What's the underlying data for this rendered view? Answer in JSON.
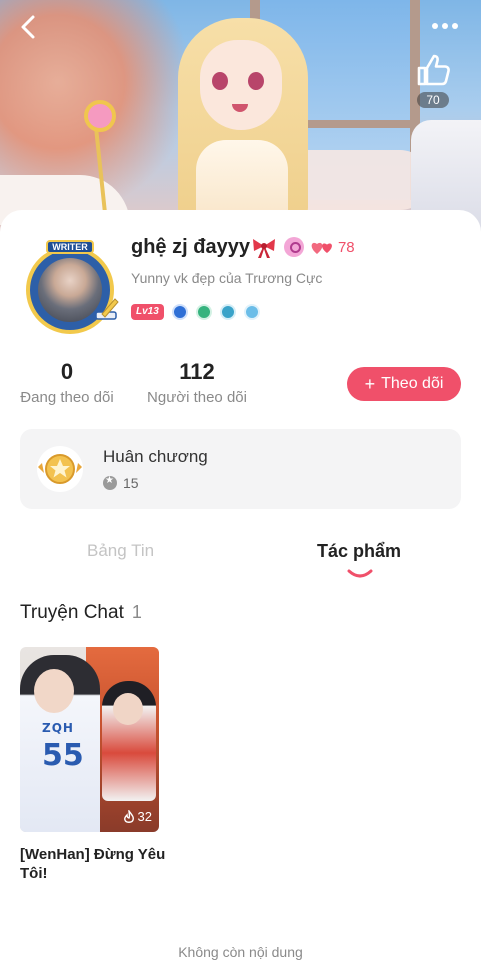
{
  "header": {
    "like_count": "70"
  },
  "profile": {
    "avatar_tag": "WRITER",
    "username": "ghệ zj đayyy",
    "hearts_count": "78",
    "bio": "Yunny vk đẹp của Trương Cực",
    "level": "Lv13"
  },
  "stats": {
    "following_value": "0",
    "following_label": "Đang theo dõi",
    "followers_value": "112",
    "followers_label": "Người theo dõi"
  },
  "follow_button": {
    "plus": "+",
    "label": "Theo dõi"
  },
  "medals": {
    "title": "Huân chương",
    "count": "15"
  },
  "tabs": [
    {
      "label": "Bảng Tin"
    },
    {
      "label": "Tác phẩm"
    }
  ],
  "works": {
    "section_title": "Truyện Chat",
    "section_count": "1",
    "items": [
      {
        "title": "[WenHan] Đừng Yêu Tôi!",
        "views": "32",
        "jersey_text": "ZQH",
        "jersey_number": "55"
      }
    ]
  },
  "footer": {
    "end_text": "Không còn nội dung"
  },
  "colors": {
    "accent": "#f0506a",
    "muted": "#8a8a8a"
  }
}
